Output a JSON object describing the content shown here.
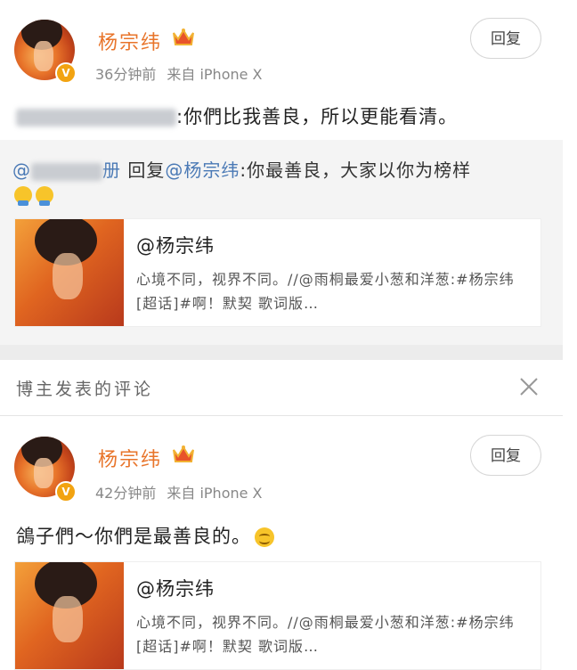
{
  "comment1": {
    "author": "杨宗纬",
    "verified_badge": "V",
    "time": "36分钟前",
    "source": "来自 iPhone X",
    "reply_label": "回复",
    "text": ":你們比我善良，所以更能看清。"
  },
  "quoted": {
    "author_suffix": "册",
    "reply_word": " 回复",
    "mention": "@杨宗纬",
    "text": ":你最善良，大家以你为榜样",
    "emoji_count": 2
  },
  "card1": {
    "title": "@杨宗纬",
    "desc": "心境不同，视界不同。//@雨桐最爱小葱和洋葱:#杨宗纬[超话]#啊！默契 歌词版…"
  },
  "section": {
    "title": "博主发表的评论",
    "close_icon": "close-icon"
  },
  "comment2": {
    "author": "杨宗纬",
    "verified_badge": "V",
    "time": "42分钟前",
    "source": "来自 iPhone X",
    "reply_label": "回复",
    "text": "鴿子們～你們是最善良的。"
  },
  "card2": {
    "title": "@杨宗纬",
    "desc": "心境不同，视界不同。//@雨桐最爱小葱和洋葱:#杨宗纬[超话]#啊！默契 歌词版…"
  },
  "colors": {
    "accent_name": "#e8742a",
    "link": "#4a79b5",
    "badge": "#f2a311"
  }
}
